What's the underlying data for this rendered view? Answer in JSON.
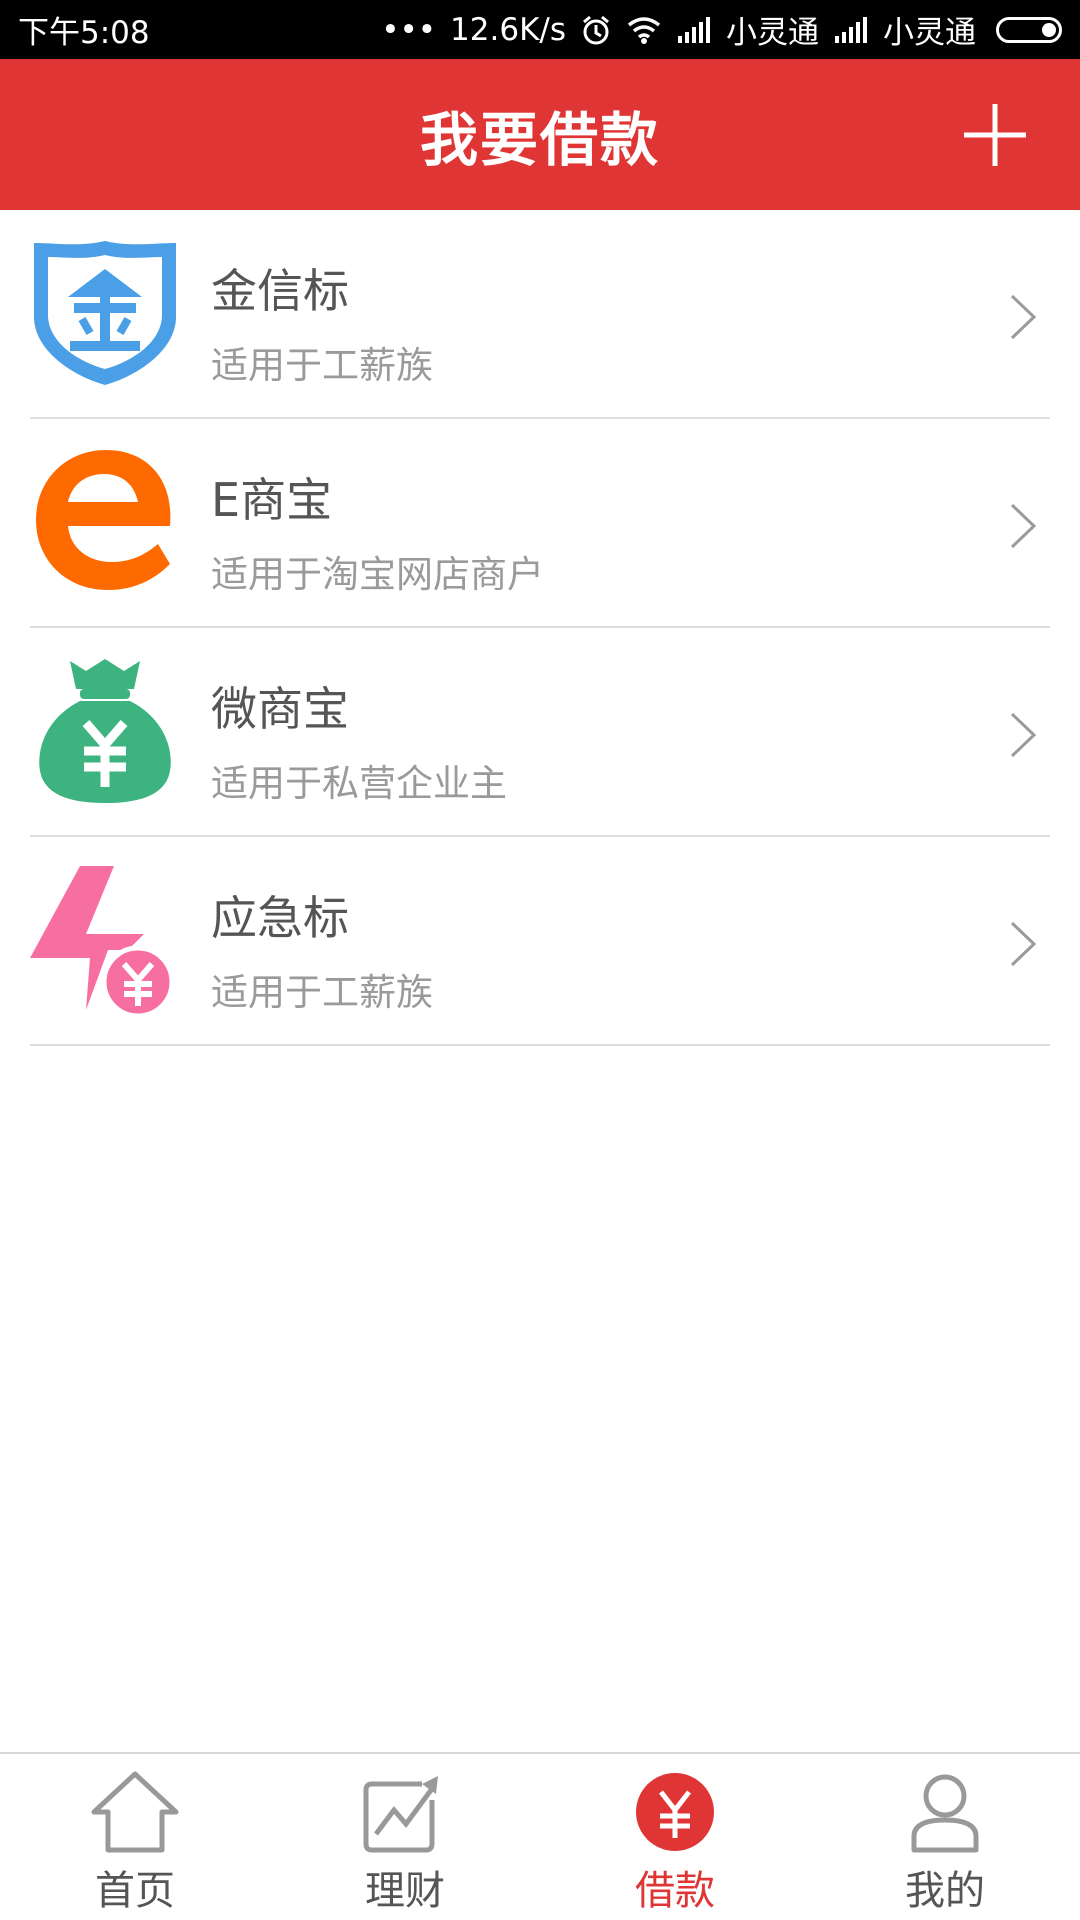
{
  "status_bar": {
    "time": "下午5:08",
    "dots": "•••",
    "speed": "12.6K/s",
    "carrier1": "小灵通",
    "carrier2": "小灵通"
  },
  "header": {
    "title": "我要借款"
  },
  "loans": [
    {
      "title": "金信标",
      "subtitle": "适用于工薪族",
      "icon": "gold-shield-icon"
    },
    {
      "title": "E商宝",
      "subtitle": "适用于淘宝网店商户",
      "icon": "e-letter-icon"
    },
    {
      "title": "微商宝",
      "subtitle": "适用于私营企业主",
      "icon": "money-bag-icon"
    },
    {
      "title": "应急标",
      "subtitle": "适用于工薪族",
      "icon": "lightning-yen-icon"
    }
  ],
  "nav": {
    "home": "首页",
    "finance": "理财",
    "borrow": "借款",
    "mine": "我的"
  },
  "colors": {
    "brand_red": "#e03535",
    "shield_blue": "#4a9fe6",
    "orange": "#ff6a00",
    "green": "#3db37f",
    "pink": "#f76fa1"
  }
}
